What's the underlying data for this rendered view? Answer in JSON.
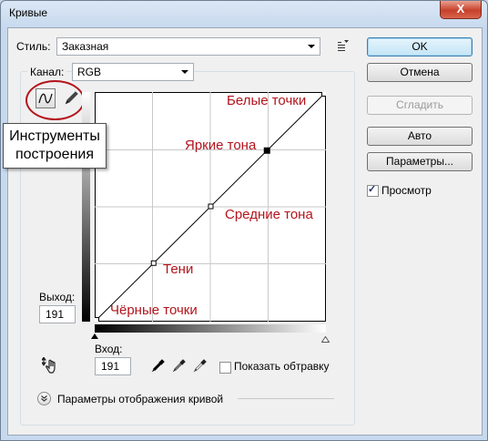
{
  "window": {
    "title": "Кривые",
    "close_glyph": "X"
  },
  "preset": {
    "label": "Стиль:",
    "value": "Заказная"
  },
  "channel": {
    "label": "Канал:",
    "value": "RGB"
  },
  "buttons": {
    "ok": "OK",
    "cancel": "Отмена",
    "smooth": "Сгладить",
    "auto": "Авто",
    "options": "Параметры..."
  },
  "preview": {
    "label": "Просмотр",
    "checked": true
  },
  "output": {
    "label": "Выход:",
    "value": "191"
  },
  "input": {
    "label": "Вход:",
    "value": "191"
  },
  "clipping": {
    "label": "Показать обтравку",
    "checked": false
  },
  "display_options": {
    "label": "Параметры отображения кривой"
  },
  "tooltip": {
    "line1": "Инструменты",
    "line2": "построения"
  },
  "annotations": {
    "white_points": "Белые точки",
    "highlights": "Яркие тона",
    "midtones": "Средние тона",
    "shadows": "Тени",
    "black_points": "Чёрные точки"
  },
  "colors": {
    "annotation": "#b3141c",
    "highlight_circle": "#b3141c"
  },
  "icons": {
    "presets_menu": "preset-menu-icon",
    "curve_tool": "curve-tool-icon",
    "pencil_tool": "pencil-tool-icon",
    "target_adjust": "hand-target-icon",
    "black_eyedropper": "black-eyedropper-icon",
    "gray_eyedropper": "gray-eyedropper-icon",
    "white_eyedropper": "white-eyedropper-icon",
    "expand": "expand-chevron-icon"
  },
  "curve_points": [
    {
      "input": 0,
      "output": 0
    },
    {
      "input": 64,
      "output": 64
    },
    {
      "input": 128,
      "output": 128
    },
    {
      "input": 191,
      "output": 191
    },
    {
      "input": 255,
      "output": 255
    }
  ]
}
